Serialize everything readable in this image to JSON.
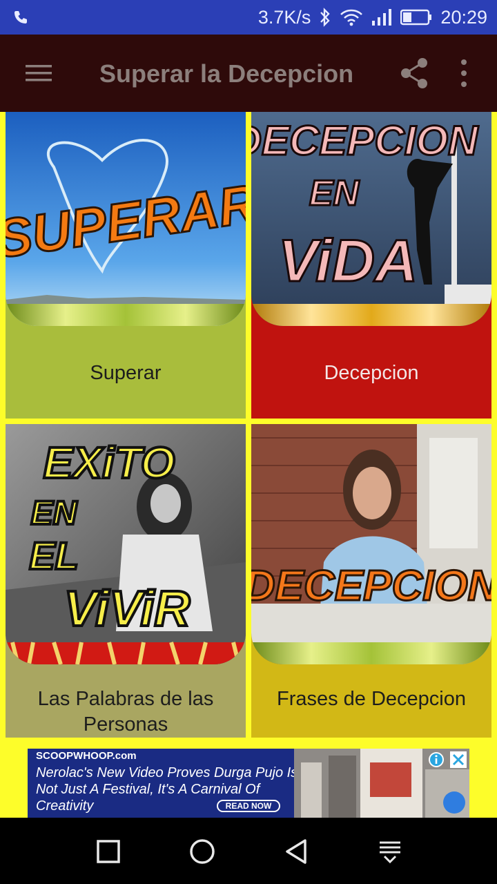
{
  "status_bar": {
    "speed": "3.7K/s",
    "time": "20:29",
    "icons": [
      "phone-icon",
      "bluetooth-icon",
      "wifi-icon",
      "signal-icon",
      "battery-icon"
    ]
  },
  "app_bar": {
    "title": "Superar la Decepcion",
    "icons": [
      "menu-icon",
      "share-icon",
      "more-vert-icon"
    ]
  },
  "cards": [
    {
      "label": "Superar",
      "thumb_text": "SUPERAR",
      "bg": "#a9bd3c",
      "label_color": "#1d1d1d"
    },
    {
      "label": "Decepcion",
      "thumb_text": [
        "DECEPCION",
        "EN",
        "ViDA"
      ],
      "bg": "#c0130f",
      "label_color": "#f3e6e6"
    },
    {
      "label": "Las Palabras de las Personas",
      "thumb_text": [
        "EXiTO",
        "EN",
        "EL",
        "ViViR"
      ],
      "bg": "#a9a661",
      "label_color": "#1d1d1d"
    },
    {
      "label": "Frases de Decepcion",
      "thumb_text": "DECEPCION",
      "bg": "#d2b816",
      "label_color": "#1d1d1d"
    }
  ],
  "ad": {
    "brand": "SCOOPWHOOP.com",
    "lines": [
      "Nerolac's New Video Proves Durga Pujo Is",
      "Not Just A Festival, It's A Carnival Of",
      "Creativity"
    ],
    "cta": "READ NOW",
    "icons": [
      "info-icon",
      "close-icon"
    ]
  },
  "nav_bar": {
    "icons": [
      "square-icon",
      "circle-icon",
      "triangle-back-icon",
      "notification-pull-icon"
    ]
  },
  "colors": {
    "status_bar": "#2b3fb6",
    "app_bar": "#2e0a0a",
    "page_bg": "#fdfd2a"
  }
}
